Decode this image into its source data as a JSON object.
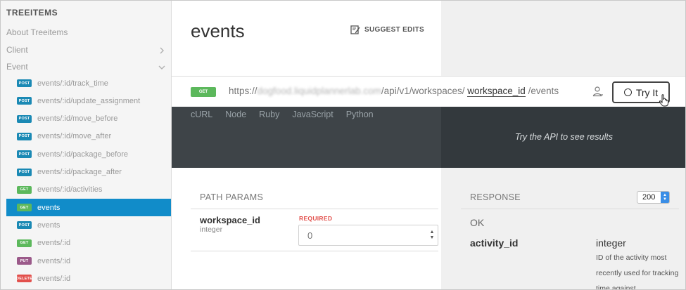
{
  "sidebar": {
    "title": "TREEITEMS",
    "links": [
      {
        "label": "About Treeitems"
      },
      {
        "label": "Client"
      },
      {
        "label": "Event"
      }
    ],
    "endpoints": [
      {
        "method": "POST",
        "label": "events/:id/track_time",
        "color": "#1a89b4"
      },
      {
        "method": "POST",
        "label": "events/:id/update_assignment",
        "color": "#1a89b4"
      },
      {
        "method": "POST",
        "label": "events/:id/move_before",
        "color": "#1a89b4"
      },
      {
        "method": "POST",
        "label": "events/:id/move_after",
        "color": "#1a89b4"
      },
      {
        "method": "POST",
        "label": "events/:id/package_before",
        "color": "#1a89b4"
      },
      {
        "method": "POST",
        "label": "events/:id/package_after",
        "color": "#1a89b4"
      },
      {
        "method": "GET",
        "label": "events/:id/activities",
        "color": "#5cb85c"
      },
      {
        "method": "GET",
        "label": "events",
        "color": "#5cb85c",
        "active": true
      },
      {
        "method": "POST",
        "label": "events",
        "color": "#1a89b4"
      },
      {
        "method": "GET",
        "label": "events/:id",
        "color": "#5cb85c"
      },
      {
        "method": "PUT",
        "label": "events/:id",
        "color": "#9b5a8a"
      },
      {
        "method": "DELETE",
        "label": "events/:id",
        "color": "#e2504c"
      }
    ]
  },
  "page": {
    "title": "events",
    "suggest_edits": "SUGGEST EDITS"
  },
  "request": {
    "method": "GET",
    "url_prefix": "https://",
    "url_host": "dogfood.liquidplannerlab.com",
    "url_path": "/api/v1/workspaces/",
    "url_param": "workspace_id",
    "url_suffix": "/events",
    "try_button": "Try It"
  },
  "code_tabs": [
    "cURL",
    "Node",
    "Ruby",
    "JavaScript",
    "Python"
  ],
  "try_message": "Try the API to see results",
  "path_params": {
    "heading": "PATH PARAMS",
    "params": [
      {
        "name": "workspace_id",
        "type": "integer",
        "required_label": "REQUIRED",
        "placeholder": "0"
      }
    ]
  },
  "response": {
    "heading": "RESPONSE",
    "status_code": "200",
    "status_text": "OK",
    "fields": [
      {
        "name": "activity_id",
        "type": "integer",
        "description": "ID of the activity most recently used for tracking time against"
      }
    ]
  },
  "colors": {
    "active": "#118cc9",
    "get": "#5cb85c",
    "post": "#1a89b4",
    "put": "#9b5a8a",
    "delete": "#e2504c",
    "required": "#e2504c"
  }
}
